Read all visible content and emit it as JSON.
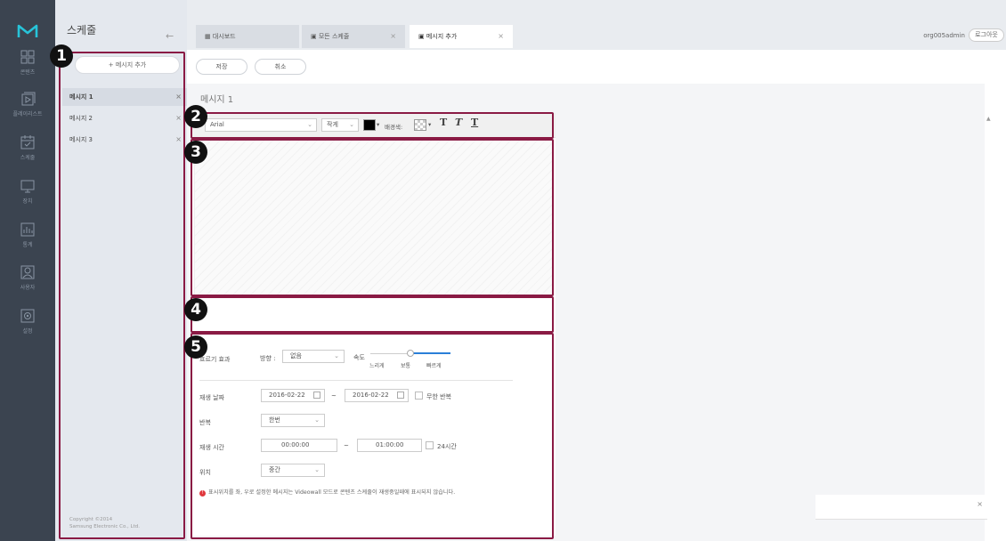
{
  "nav": {
    "items": [
      {
        "label": "콘텐츠",
        "icon": "content-icon"
      },
      {
        "label": "플레이리스트",
        "icon": "playlist-icon"
      },
      {
        "label": "스케줄",
        "icon": "schedule-icon"
      },
      {
        "label": "장치",
        "icon": "device-icon"
      },
      {
        "label": "통계",
        "icon": "statistics-icon"
      },
      {
        "label": "사용자",
        "icon": "user-icon"
      },
      {
        "label": "설정",
        "icon": "settings-icon"
      }
    ]
  },
  "side": {
    "title": "스케줄",
    "back": "←",
    "add_label": "+ 메시지 추가",
    "messages": [
      {
        "label": "메시지 1"
      },
      {
        "label": "메시지 2"
      },
      {
        "label": "메시지 3"
      }
    ],
    "close": "×",
    "copyright_1": "Copyright ©2014",
    "copyright_2": "Samsung Electronic Co., Ltd."
  },
  "tabs": [
    {
      "label": "대시보드",
      "icon": "dashboard-icon"
    },
    {
      "label": "모든 스케줄",
      "icon": "schedule-icon"
    },
    {
      "label": "메시지 추가",
      "icon": "message-icon"
    }
  ],
  "tab_close": "×",
  "user": {
    "name": "org005admin",
    "logout": "로그아웃"
  },
  "actions": {
    "save": "저장",
    "cancel": "취소"
  },
  "editor": {
    "message_title": "메시지 1",
    "font": "Arial",
    "size": "작게",
    "text_color": "#000000",
    "bg_label": "배경색:",
    "bold": "T",
    "italic": "T",
    "underline": "T"
  },
  "options": {
    "scroll_effect_label": "흐르기 효과",
    "direction_label": "방향 :",
    "direction_value": "없음",
    "speed_label": "속도",
    "speed_slow": "느리게",
    "speed_normal": "보통",
    "speed_fast": "빠르게",
    "speed_level": 0.5,
    "play_date_label": "재생 날짜",
    "start_date": "2016-02-22",
    "end_date": "2016-02-22",
    "tilde": "~",
    "infinite_label": "무한 반복",
    "repeat_label": "반복",
    "repeat_value": "한번",
    "play_time_label": "재생 시간",
    "start_time": "00:00:00",
    "end_time": "01:00:00",
    "allday_label": "24시간",
    "position_label": "위치",
    "position_value": "중간",
    "warning": "표시위치를 좌, 우로 설정한 메시지는 Videowall 모드로 콘텐츠 스케줄이 재생중일때에 표시되지 않습니다."
  },
  "callouts": [
    "1",
    "2",
    "3",
    "4",
    "5"
  ],
  "colors": {
    "rail": "#3b4450",
    "accent": "#8a1a44",
    "warning": "#e0393e"
  }
}
